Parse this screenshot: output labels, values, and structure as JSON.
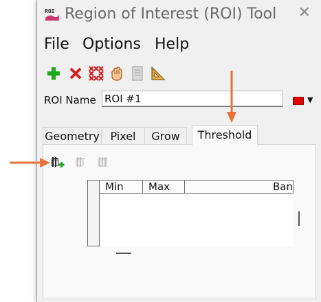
{
  "window": {
    "title": "Region of Interest (ROI) Tool",
    "app_icon_text": "ROI",
    "close_glyph": "✕"
  },
  "menu": [
    "File",
    "Options",
    "Help"
  ],
  "toolbar": [
    {
      "icon": "add-icon"
    },
    {
      "icon": "delete-icon"
    },
    {
      "icon": "delete-all-icon"
    },
    {
      "icon": "grab-hand-icon"
    },
    {
      "icon": "file-icon"
    },
    {
      "icon": "set-square-icon"
    }
  ],
  "roi": {
    "label": "ROI Name",
    "value": "ROI #1",
    "color": "#e00000"
  },
  "tabs": [
    {
      "label": "Geometry"
    },
    {
      "label": "Pixel"
    },
    {
      "label": "Grow"
    },
    {
      "label": "Threshold",
      "active": true
    }
  ],
  "threshold_toolbar": [
    {
      "icon": "add-threshold-icon",
      "enabled": true
    },
    {
      "icon": "edit-threshold-icon",
      "enabled": false
    },
    {
      "icon": "remove-threshold-icon",
      "enabled": false
    }
  ],
  "table": {
    "columns": [
      "Min",
      "Max",
      "Ban"
    ],
    "rows": []
  },
  "annotations": {
    "arrow_color": "#e8703a"
  }
}
